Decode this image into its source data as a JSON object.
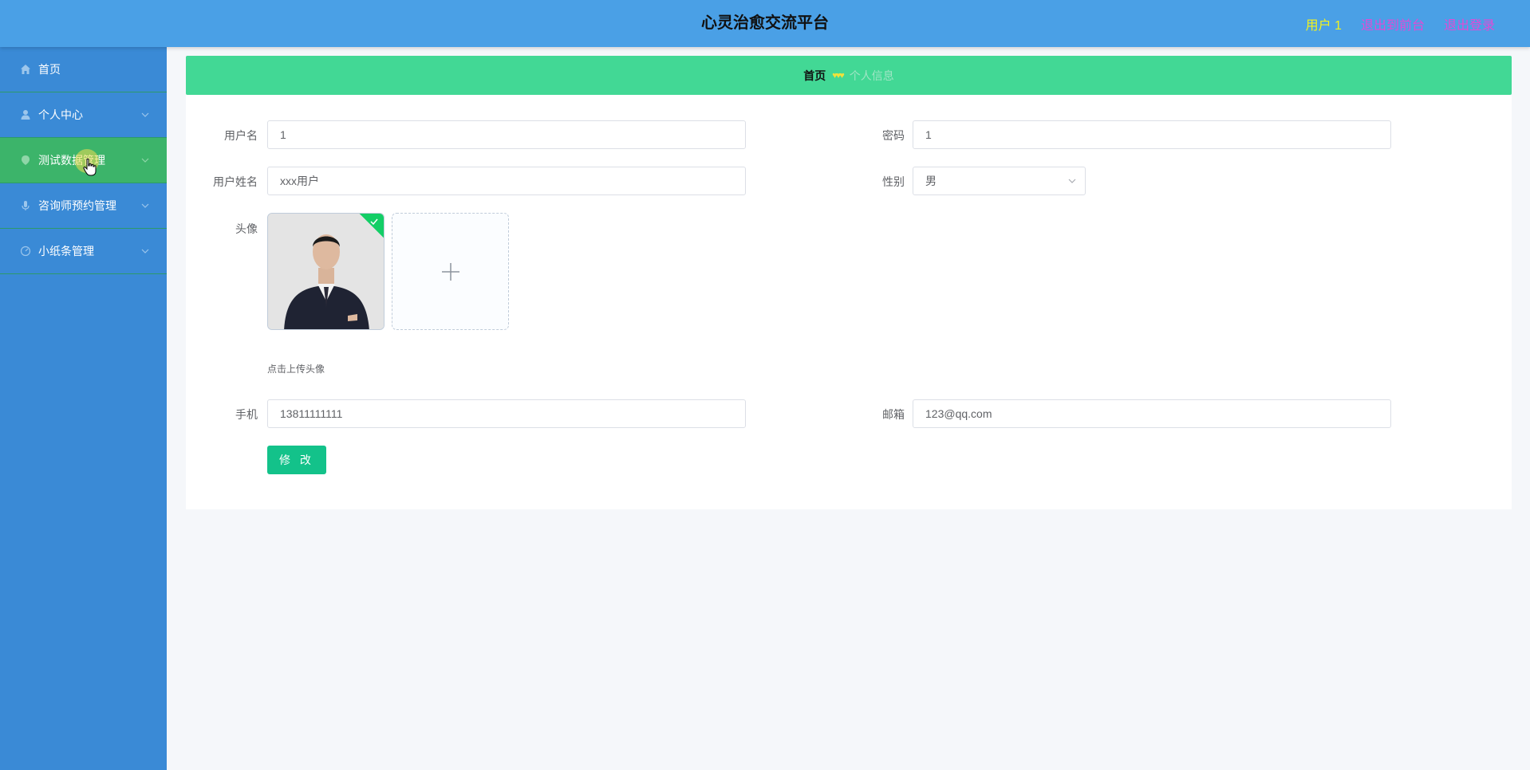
{
  "header": {
    "title": "心灵治愈交流平台",
    "user": "用户 1",
    "to_front": "退出到前台",
    "logout": "退出登录"
  },
  "sidebar": {
    "items": [
      {
        "label": "首页",
        "icon": "home-icon"
      },
      {
        "label": "个人中心",
        "icon": "user-icon"
      },
      {
        "label": "测试数据管理",
        "icon": "data-icon"
      },
      {
        "label": "咨询师预约管理",
        "icon": "microphone-icon"
      },
      {
        "label": "小纸条管理",
        "icon": "dashboard-icon"
      }
    ]
  },
  "breadcrumb": {
    "home": "首页",
    "separator": "♥♥♥",
    "current": "个人信息"
  },
  "form": {
    "username_label": "用户名",
    "username_value": "1",
    "password_label": "密码",
    "password_value": "1",
    "realname_label": "用户姓名",
    "realname_value": "xxx用户",
    "gender_label": "性别",
    "gender_value": "男",
    "avatar_label": "头像",
    "avatar_hint": "点击上传头像",
    "phone_label": "手机",
    "phone_value": "13811111111",
    "email_label": "邮箱",
    "email_value": "123@qq.com",
    "submit_label": "修 改"
  },
  "colors": {
    "header_bg": "#4aa0e6",
    "sidebar_bg": "#3a8ad6",
    "active_menu": "#3cb46a",
    "breadcrumb_bg": "#42d895",
    "button": "#13c28a"
  }
}
